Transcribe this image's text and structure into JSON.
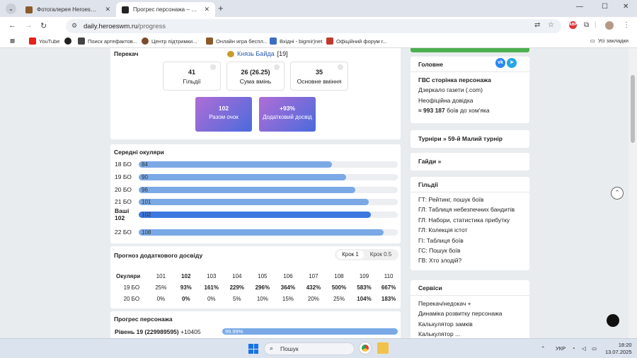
{
  "browser": {
    "tabs": [
      {
        "title": "Фотогалерея HeroesWM. Княз",
        "active": false,
        "favicon_color": "#8a5a2b"
      },
      {
        "title": "Прогрес персонажа – HWM D",
        "active": true,
        "favicon_color": "#222222"
      }
    ],
    "tab_close": "✕",
    "new_tab": "+",
    "url_host": "daily.heroeswm.ru",
    "url_path": "/progress",
    "bookmarks": [
      {
        "label": "YouTube",
        "color": "#e62117"
      },
      {
        "label": "",
        "color": "#222222"
      },
      {
        "label": "Поиск артефактов...",
        "color": "#444444"
      },
      {
        "label": "Центр підтримки...",
        "color": "#7a4a2a"
      },
      {
        "label": "Онлайн игра беспл...",
        "color": "#8a5a2b"
      },
      {
        "label": "Вхідні - bigmir)net",
        "color": "#3a6fc0"
      },
      {
        "label": "Офіційний форум г...",
        "color": "#c0392b"
      }
    ],
    "all_bookmarks": "Усі закладки"
  },
  "header": {
    "role": "Перекач",
    "hero_name": "Князь Байда",
    "hero_level": "[19]",
    "stats": [
      {
        "value": "41",
        "label": "Гільдії"
      },
      {
        "value": "26 (26.25)",
        "label": "Сума вмінь"
      },
      {
        "value": "35",
        "label": "Основне вміння"
      }
    ],
    "grad": [
      {
        "value": "102",
        "label": "Разом очок"
      },
      {
        "value": "+93%",
        "label": "Додатковий досвід"
      }
    ]
  },
  "avg_points": {
    "title": "Середні окуляри",
    "rows": [
      {
        "label": "18 БО",
        "value": "84",
        "fraction": 0.746,
        "current": false
      },
      {
        "label": "19 БО",
        "value": "90",
        "fraction": 0.8,
        "current": false
      },
      {
        "label": "20 БО",
        "value": "96",
        "fraction": 0.836,
        "current": false
      },
      {
        "label": "21 БО",
        "value": "101",
        "fraction": 0.888,
        "current": false
      },
      {
        "label": "Ваші 102",
        "value": "102",
        "fraction": 0.897,
        "current": true
      },
      {
        "label": "22 БО",
        "value": "108",
        "fraction": 0.945,
        "current": false
      }
    ]
  },
  "forecast": {
    "title": "Прогноз додаткового досвіду",
    "step_active": "Крок 1",
    "step_other": "Крок 0.5",
    "header": [
      "Окуляри",
      "101",
      "102",
      "103",
      "104",
      "105",
      "106",
      "107",
      "108",
      "109",
      "110"
    ],
    "bold_header": [
      false,
      false,
      true,
      false,
      false,
      false,
      false,
      false,
      false,
      false,
      false
    ],
    "rows": [
      {
        "cells": [
          "19 БО",
          "25%",
          "93%",
          "161%",
          "229%",
          "296%",
          "364%",
          "432%",
          "500%",
          "583%",
          "667%"
        ],
        "bold": [
          false,
          false,
          true,
          true,
          true,
          true,
          true,
          true,
          true,
          true,
          true
        ]
      },
      {
        "cells": [
          "20 БО",
          "0%",
          "0%",
          "0%",
          "5%",
          "10%",
          "15%",
          "20%",
          "25%",
          "104%",
          "183%"
        ],
        "bold": [
          false,
          false,
          true,
          false,
          false,
          false,
          false,
          false,
          false,
          true,
          true
        ]
      }
    ]
  },
  "progress": {
    "title": "Прогрес персонажа",
    "level_label": "Рівень  19 (229989595)",
    "level_extra": "+10405",
    "bar_value": "99.99%",
    "fraction": 0.9999
  },
  "sidebar": {
    "main": {
      "title": "Головне",
      "items": [
        "ГВС сторінка персонажа",
        "Дзеркало газети (.com)",
        "Неофіційна довідка",
        "≈ 993 187 боїв до хом'яка"
      ],
      "bold_prefix": [
        "",
        "",
        "",
        "≈ 993 187"
      ],
      "vk": "vk",
      "tg": "➤"
    },
    "tournaments": "Турніри » 59-й Малий турнір",
    "guides": "Гайди »",
    "guilds": {
      "title": "Гільдії",
      "items": [
        "ГТ: Рейтинг, пошук боїв",
        "ГЛ: Таблиця небезпечних бандитів",
        "ГЛ: Набори, статистика прибутку",
        "ГЛ: Колекція істот",
        "ГІ: Таблиця боїв",
        "ГС: Пошук боїв",
        "ГВ: Хто злодій?"
      ]
    },
    "services": {
      "title": "Сервіси",
      "items": [
        "Перекач/недокач +",
        "Динаміка розвитку персонажа",
        "Калькулятор замків",
        "Калькулятор ..."
      ]
    }
  },
  "taskbar": {
    "search": "Пошук",
    "lang": "УКР",
    "time": "18:20",
    "date": "13.07.2025"
  },
  "colors": {
    "accent": "#3c78e0",
    "bar": "#7aa9e6",
    "green": "#4caf50",
    "vk": "#2787f5",
    "tg": "#27a6e5"
  }
}
